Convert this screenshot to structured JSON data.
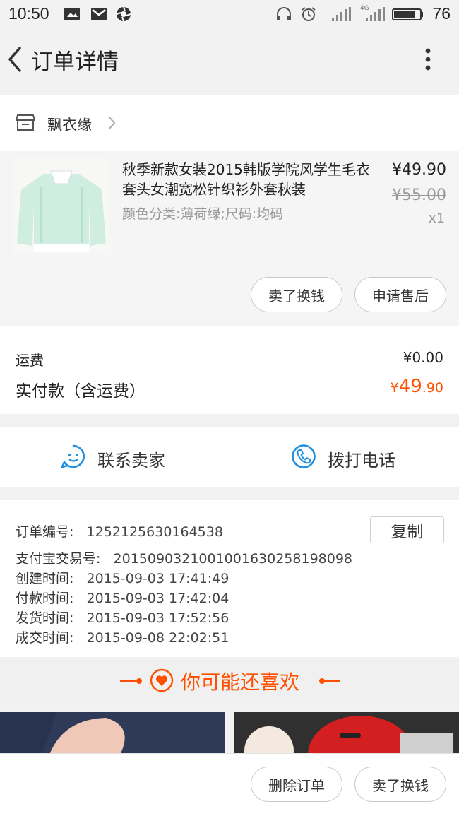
{
  "status": {
    "time": "10:50",
    "battery": "76",
    "network": "4G"
  },
  "header": {
    "title": "订单详情"
  },
  "shop": {
    "name": "飘衣缘"
  },
  "product": {
    "title": "秋季新款女装2015韩版学院风学生毛衣套头女潮宽松针织衫外套秋装",
    "spec": "颜色分类:薄荷绿;尺码:均码",
    "price": "¥49.90",
    "original_price": "¥55.00",
    "quantity": "x1",
    "actions": [
      "卖了换钱",
      "申请售后"
    ]
  },
  "fees": {
    "shipping_label": "运费",
    "shipping_value": "¥0.00",
    "paid_label": "实付款（含运费）",
    "paid_currency": "¥",
    "paid_int": "49",
    "paid_dec": ".90"
  },
  "contact": {
    "seller_label": "联系卖家",
    "phone_label": "拨打电话"
  },
  "order": {
    "copy_label": "复制",
    "rows": [
      {
        "label": "订单编号:",
        "value": "1252125630164538"
      },
      {
        "label": "支付宝交易号:",
        "value": "2015090321001001630258198098"
      },
      {
        "label": "创建时间:",
        "value": "2015-09-03 17:41:49"
      },
      {
        "label": "付款时间:",
        "value": "2015-09-03 17:42:04"
      },
      {
        "label": "发货时间:",
        "value": "2015-09-03 17:52:56"
      },
      {
        "label": "成交时间:",
        "value": "2015-09-08 22:02:51"
      }
    ]
  },
  "recommend": {
    "title": "你可能还喜欢"
  },
  "bottom": {
    "delete_label": "删除订单",
    "sell_label": "卖了换钱"
  },
  "colors": {
    "accent": "#ff5000",
    "blue": "#1e8fe1",
    "bg": "#f2f2f2"
  }
}
